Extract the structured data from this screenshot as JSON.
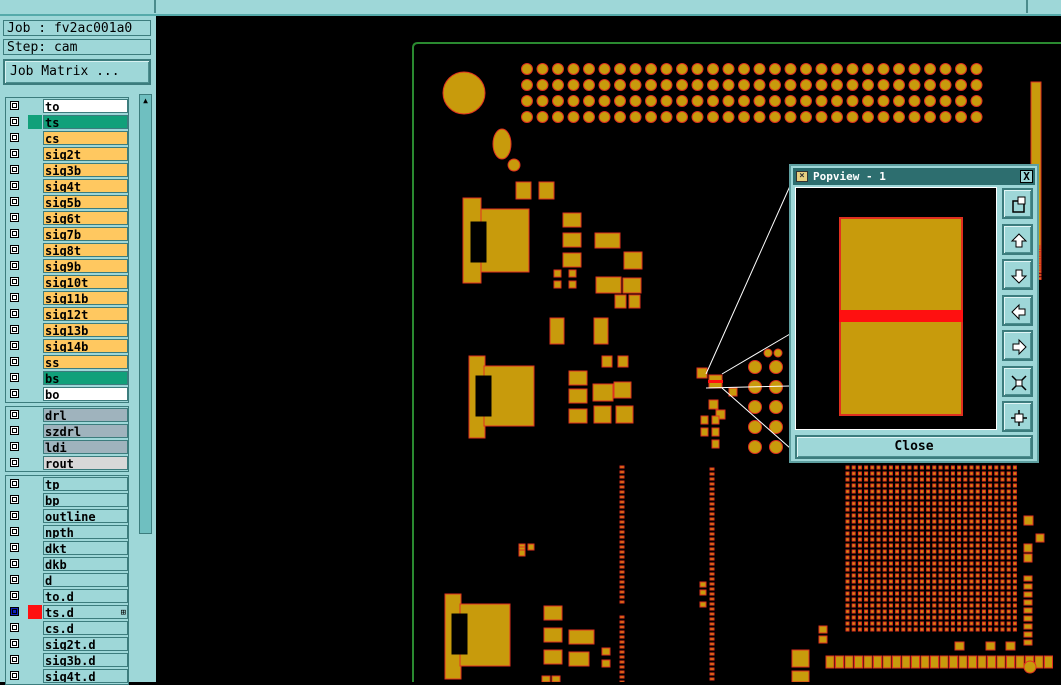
{
  "header": {
    "job_label": "Job : fv2ac001a0",
    "step_label": "Step: cam",
    "job_matrix_button": "Job Matrix ..."
  },
  "layer_groups": [
    {
      "name": "board-layers",
      "layers": [
        {
          "name": "to",
          "color": "#ffffff",
          "swatch": ""
        },
        {
          "name": "ts",
          "color": "#11a07a",
          "swatch": "#11a07a"
        },
        {
          "name": "cs",
          "color": "#ffc860",
          "swatch": ""
        },
        {
          "name": "sig2t",
          "color": "#ffc860",
          "swatch": ""
        },
        {
          "name": "sig3b",
          "color": "#ffc860",
          "swatch": ""
        },
        {
          "name": "sig4t",
          "color": "#ffc860",
          "swatch": ""
        },
        {
          "name": "sig5b",
          "color": "#ffc860",
          "swatch": ""
        },
        {
          "name": "sig6t",
          "color": "#ffc860",
          "swatch": ""
        },
        {
          "name": "sig7b",
          "color": "#ffc860",
          "swatch": ""
        },
        {
          "name": "sig8t",
          "color": "#ffc860",
          "swatch": ""
        },
        {
          "name": "sig9b",
          "color": "#ffc860",
          "swatch": ""
        },
        {
          "name": "sig10t",
          "color": "#ffc860",
          "swatch": ""
        },
        {
          "name": "sig11b",
          "color": "#ffc860",
          "swatch": ""
        },
        {
          "name": "sig12t",
          "color": "#ffc860",
          "swatch": ""
        },
        {
          "name": "sig13b",
          "color": "#ffc860",
          "swatch": ""
        },
        {
          "name": "sig14b",
          "color": "#ffc860",
          "swatch": ""
        },
        {
          "name": "ss",
          "color": "#ffc860",
          "swatch": ""
        },
        {
          "name": "bs",
          "color": "#11a07a",
          "swatch": ""
        },
        {
          "name": "bo",
          "color": "#ffffff",
          "swatch": ""
        }
      ]
    },
    {
      "name": "drill-layers",
      "layers": [
        {
          "name": "drl",
          "color": "#9fb3bd",
          "swatch": ""
        },
        {
          "name": "szdrl",
          "color": "#9fb3bd",
          "swatch": ""
        },
        {
          "name": "ldi",
          "color": "#9fb3bd",
          "swatch": ""
        },
        {
          "name": "rout",
          "color": "#d8d8d8",
          "swatch": ""
        }
      ]
    },
    {
      "name": "misc-layers",
      "layers": [
        {
          "name": "tp",
          "color": "#9ed7d8",
          "swatch": ""
        },
        {
          "name": "bp",
          "color": "#9ed7d8",
          "swatch": ""
        },
        {
          "name": "outline",
          "color": "#9ed7d8",
          "swatch": ""
        },
        {
          "name": "npth",
          "color": "#9ed7d8",
          "swatch": ""
        },
        {
          "name": "dkt",
          "color": "#9ed7d8",
          "swatch": ""
        },
        {
          "name": "dkb",
          "color": "#9ed7d8",
          "swatch": ""
        },
        {
          "name": "d",
          "color": "#9ed7d8",
          "swatch": ""
        },
        {
          "name": "to.d",
          "color": "#9ed7d8",
          "swatch": ""
        },
        {
          "name": "ts.d",
          "color": "#9ed7d8",
          "swatch": "#ff1010",
          "active": true
        },
        {
          "name": "cs.d",
          "color": "#9ed7d8",
          "swatch": ""
        },
        {
          "name": "sig2t.d",
          "color": "#9ed7d8",
          "swatch": ""
        },
        {
          "name": "sig3b.d",
          "color": "#9ed7d8",
          "swatch": ""
        },
        {
          "name": "sig4t.d",
          "color": "#9ed7d8",
          "swatch": ""
        }
      ]
    }
  ],
  "popview": {
    "title": "Popview - 1",
    "close_label": "Close",
    "close_x": "X",
    "tools": [
      "zoom-in-icon",
      "pan-up-icon",
      "pan-down-icon",
      "pan-left-icon",
      "pan-right-icon",
      "fit-screen-icon",
      "zoom-extents-icon"
    ]
  },
  "colors": {
    "pad": "#c89b0c",
    "pad_edge": "#e03020",
    "highlight": "#ff0000",
    "board_outline": "#2a8a30",
    "panel": "#9ed7d8"
  }
}
